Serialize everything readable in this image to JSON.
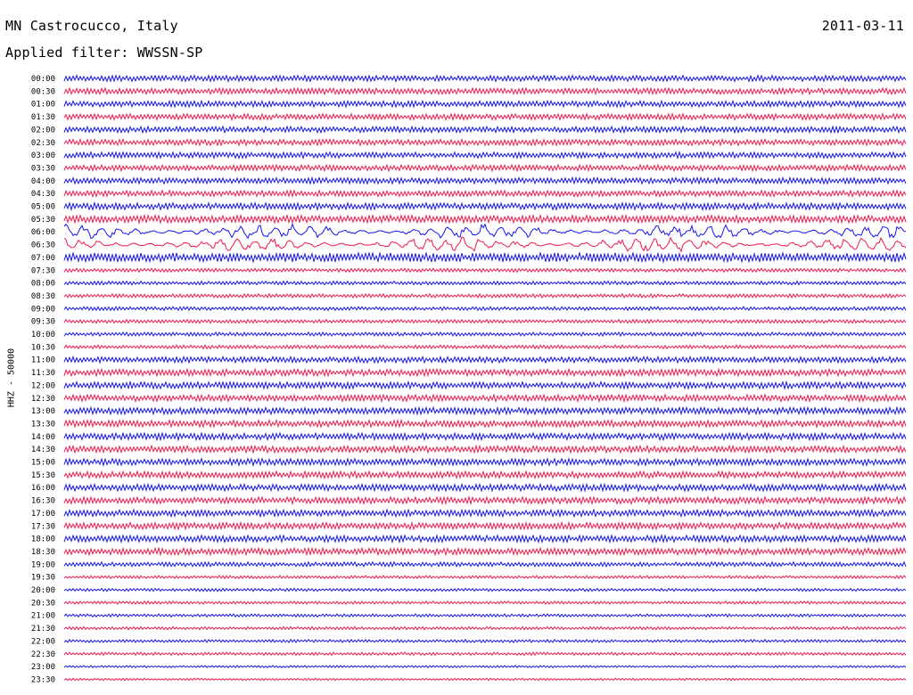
{
  "header": {
    "station": "MN Castrocucco, Italy",
    "date": "2011-03-11",
    "filter": "Applied filter: WWSSN-SP"
  },
  "axis": {
    "channel_label": "HHZ - 50000"
  },
  "colors": {
    "even_trace": "#1414f0",
    "odd_trace": "#f0194b",
    "background": "#ffffff",
    "text": "#000000"
  },
  "chart_data": {
    "type": "helicorder",
    "title": "MN Castrocucco, Italy",
    "date": "2011-03-11",
    "filter": "WWSSN-SP",
    "channel": "HHZ",
    "scale": 50000,
    "row_minutes": 30,
    "color_cycle": [
      "#1414f0",
      "#f0194b"
    ],
    "rows": [
      {
        "label": "00:00",
        "activity": 0.8
      },
      {
        "label": "00:30",
        "activity": 0.8
      },
      {
        "label": "01:00",
        "activity": 0.8
      },
      {
        "label": "01:30",
        "activity": 0.8
      },
      {
        "label": "02:00",
        "activity": 0.8
      },
      {
        "label": "02:30",
        "activity": 0.8
      },
      {
        "label": "03:00",
        "activity": 0.8
      },
      {
        "label": "03:30",
        "activity": 0.8
      },
      {
        "label": "04:00",
        "activity": 0.8
      },
      {
        "label": "04:30",
        "activity": 0.8
      },
      {
        "label": "05:00",
        "activity": 0.9
      },
      {
        "label": "05:30",
        "activity": 1.0
      },
      {
        "label": "06:00",
        "activity": 2.2
      },
      {
        "label": "06:30",
        "activity": 2.0
      },
      {
        "label": "07:00",
        "activity": 1.2
      },
      {
        "label": "07:30",
        "activity": 0.5
      },
      {
        "label": "08:00",
        "activity": 0.5
      },
      {
        "label": "08:30",
        "activity": 0.5
      },
      {
        "label": "09:00",
        "activity": 0.5
      },
      {
        "label": "09:30",
        "activity": 0.5
      },
      {
        "label": "10:00",
        "activity": 0.5
      },
      {
        "label": "10:30",
        "activity": 0.5
      },
      {
        "label": "11:00",
        "activity": 0.8
      },
      {
        "label": "11:30",
        "activity": 0.9
      },
      {
        "label": "12:00",
        "activity": 0.9
      },
      {
        "label": "12:30",
        "activity": 0.9
      },
      {
        "label": "13:00",
        "activity": 0.9
      },
      {
        "label": "13:30",
        "activity": 0.9
      },
      {
        "label": "14:00",
        "activity": 0.9
      },
      {
        "label": "14:30",
        "activity": 0.9
      },
      {
        "label": "15:00",
        "activity": 0.9
      },
      {
        "label": "15:30",
        "activity": 0.9
      },
      {
        "label": "16:00",
        "activity": 0.9
      },
      {
        "label": "16:30",
        "activity": 0.9
      },
      {
        "label": "17:00",
        "activity": 0.9
      },
      {
        "label": "17:30",
        "activity": 0.9
      },
      {
        "label": "18:00",
        "activity": 0.9
      },
      {
        "label": "18:30",
        "activity": 0.9
      },
      {
        "label": "19:00",
        "activity": 0.6
      },
      {
        "label": "19:30",
        "activity": 0.4
      },
      {
        "label": "20:00",
        "activity": 0.4
      },
      {
        "label": "20:30",
        "activity": 0.4
      },
      {
        "label": "21:00",
        "activity": 0.4
      },
      {
        "label": "21:30",
        "activity": 0.4
      },
      {
        "label": "22:00",
        "activity": 0.4
      },
      {
        "label": "22:30",
        "activity": 0.4
      },
      {
        "label": "23:00",
        "activity": 0.3
      },
      {
        "label": "23:30",
        "activity": 0.3
      }
    ]
  }
}
